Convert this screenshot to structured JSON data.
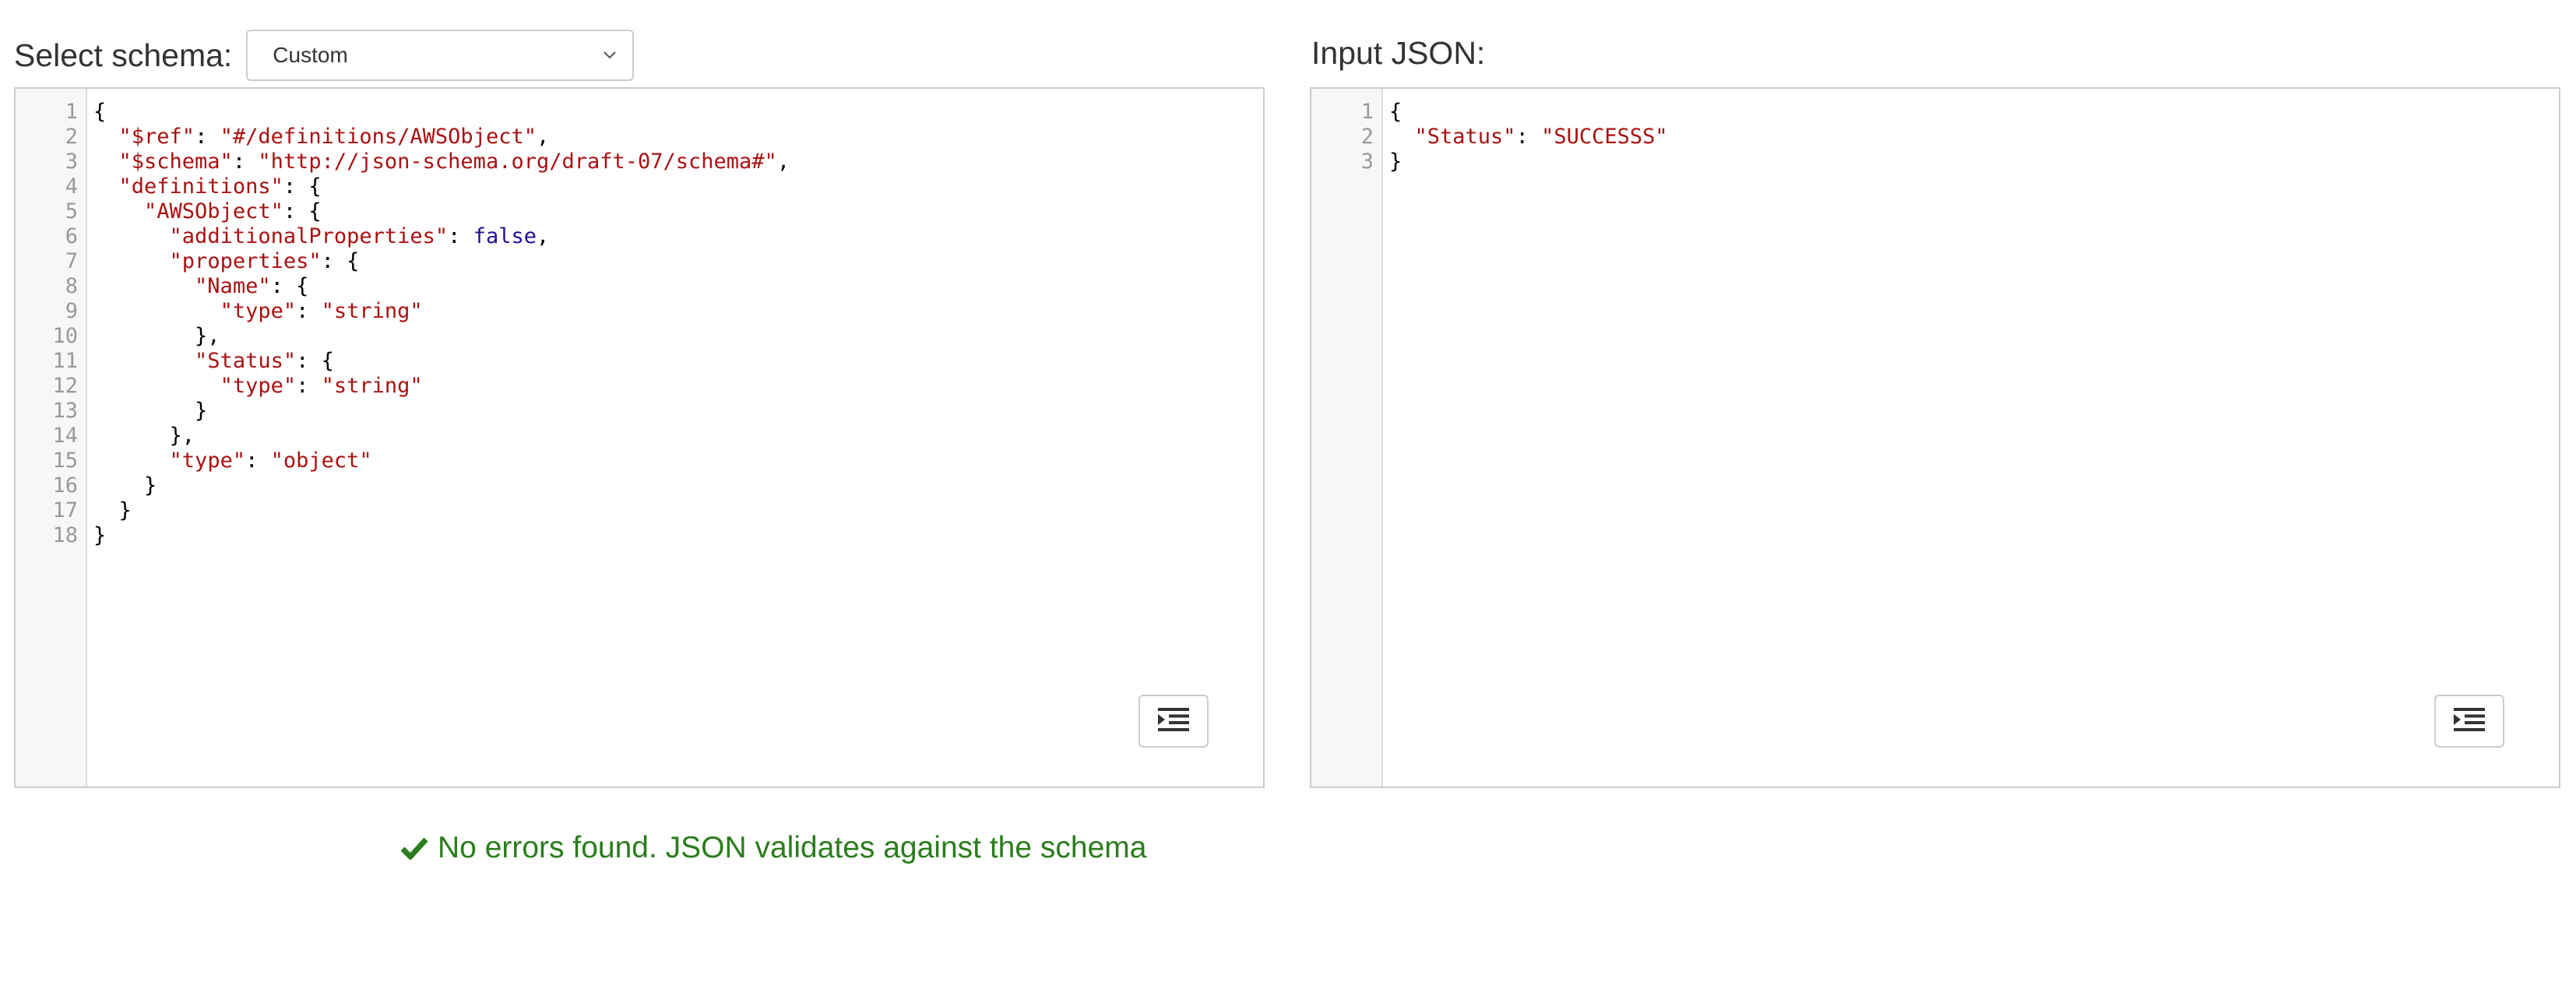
{
  "schema_panel": {
    "label": "Select schema:",
    "selected": "Custom",
    "lines": [
      [
        {
          "t": "p",
          "v": "{"
        }
      ],
      [
        {
          "t": "p",
          "v": "  "
        },
        {
          "t": "s",
          "v": "\"$ref\""
        },
        {
          "t": "p",
          "v": ": "
        },
        {
          "t": "s",
          "v": "\"#/definitions/AWSObject\""
        },
        {
          "t": "p",
          "v": ","
        }
      ],
      [
        {
          "t": "p",
          "v": "  "
        },
        {
          "t": "s",
          "v": "\"$schema\""
        },
        {
          "t": "p",
          "v": ": "
        },
        {
          "t": "s",
          "v": "\"http://json-schema.org/draft-07/schema#\""
        },
        {
          "t": "p",
          "v": ","
        }
      ],
      [
        {
          "t": "p",
          "v": "  "
        },
        {
          "t": "s",
          "v": "\"definitions\""
        },
        {
          "t": "p",
          "v": ": {"
        }
      ],
      [
        {
          "t": "p",
          "v": "    "
        },
        {
          "t": "s",
          "v": "\"AWSObject\""
        },
        {
          "t": "p",
          "v": ": {"
        }
      ],
      [
        {
          "t": "p",
          "v": "      "
        },
        {
          "t": "s",
          "v": "\"additionalProperties\""
        },
        {
          "t": "p",
          "v": ": "
        },
        {
          "t": "k",
          "v": "false"
        },
        {
          "t": "p",
          "v": ","
        }
      ],
      [
        {
          "t": "p",
          "v": "      "
        },
        {
          "t": "s",
          "v": "\"properties\""
        },
        {
          "t": "p",
          "v": ": {"
        }
      ],
      [
        {
          "t": "p",
          "v": "        "
        },
        {
          "t": "s",
          "v": "\"Name\""
        },
        {
          "t": "p",
          "v": ": {"
        }
      ],
      [
        {
          "t": "p",
          "v": "          "
        },
        {
          "t": "s",
          "v": "\"type\""
        },
        {
          "t": "p",
          "v": ": "
        },
        {
          "t": "s",
          "v": "\"string\""
        }
      ],
      [
        {
          "t": "p",
          "v": "        },"
        }
      ],
      [
        {
          "t": "p",
          "v": "        "
        },
        {
          "t": "s",
          "v": "\"Status\""
        },
        {
          "t": "p",
          "v": ": {"
        }
      ],
      [
        {
          "t": "p",
          "v": "          "
        },
        {
          "t": "s",
          "v": "\"type\""
        },
        {
          "t": "p",
          "v": ": "
        },
        {
          "t": "s",
          "v": "\"string\""
        }
      ],
      [
        {
          "t": "p",
          "v": "        }"
        }
      ],
      [
        {
          "t": "p",
          "v": "      },"
        }
      ],
      [
        {
          "t": "p",
          "v": "      "
        },
        {
          "t": "s",
          "v": "\"type\""
        },
        {
          "t": "p",
          "v": ": "
        },
        {
          "t": "s",
          "v": "\"object\""
        }
      ],
      [
        {
          "t": "p",
          "v": "    }"
        }
      ],
      [
        {
          "t": "p",
          "v": "  }"
        }
      ],
      [
        {
          "t": "p",
          "v": "}"
        }
      ]
    ]
  },
  "input_panel": {
    "label": "Input JSON:",
    "lines": [
      [
        {
          "t": "p",
          "v": "{"
        }
      ],
      [
        {
          "t": "p",
          "v": "  "
        },
        {
          "t": "s",
          "v": "\"Status\""
        },
        {
          "t": "p",
          "v": ": "
        },
        {
          "t": "s",
          "v": "\"SUCCESSS\""
        }
      ],
      [
        {
          "t": "p",
          "v": "}"
        }
      ]
    ]
  },
  "status": {
    "message": "No errors found. JSON validates against the schema"
  },
  "colors": {
    "string": "#aa1111",
    "keyword": "#221199",
    "success": "#2a7d1c"
  }
}
